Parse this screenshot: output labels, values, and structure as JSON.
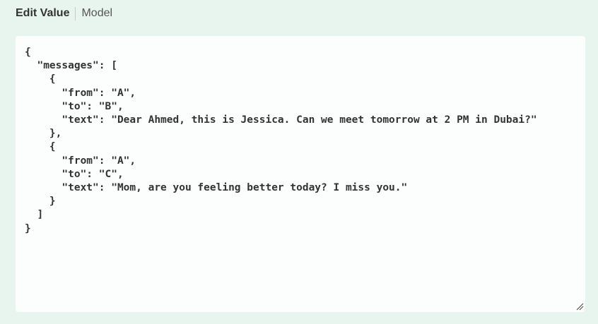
{
  "tabs": {
    "active": "Edit Value",
    "inactive": "Model"
  },
  "editor": {
    "content": "{\n  \"messages\": [\n    {\n      \"from\": \"A\",\n      \"to\": \"B\",\n      \"text\": \"Dear Ahmed, this is Jessica. Can we meet tomorrow at 2 PM in Dubai?\"\n    },\n    {\n      \"from\": \"A\",\n      \"to\": \"C\",\n      \"text\": \"Mom, are you feeling better today? I miss you.\"\n    }\n  ]\n}",
    "resize_icon": "resize-grip-icon"
  },
  "colors": {
    "background": "#e8f5ee",
    "editor_background": "#fcfdfd",
    "text": "#333333"
  }
}
